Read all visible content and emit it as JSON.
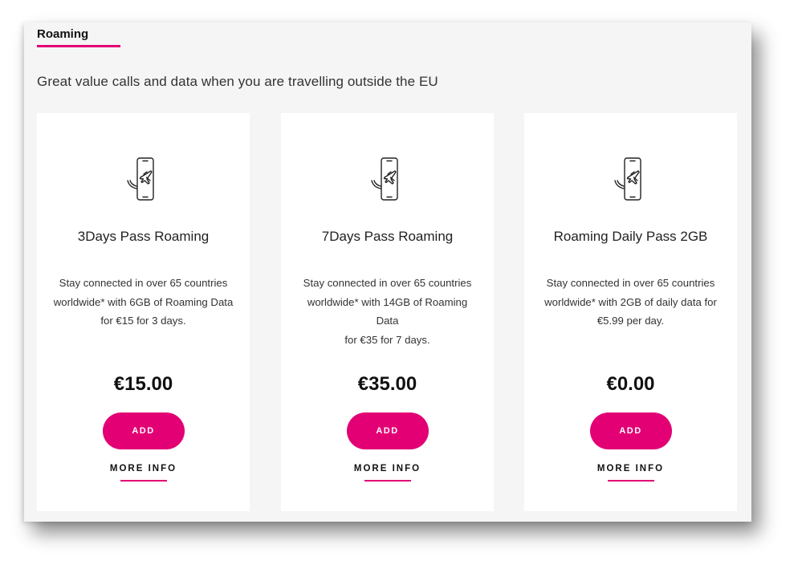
{
  "tab": {
    "label": "Roaming"
  },
  "subtitle": "Great value calls and data when you are travelling outside the EU",
  "colors": {
    "accent": "#e20074"
  },
  "cards": [
    {
      "icon": "roaming-phone-plane-icon",
      "title": "3Days Pass Roaming",
      "desc": [
        "Stay connected in over 65 countries",
        "worldwide* with 6GB of Roaming Data",
        "for €15 for 3 days."
      ],
      "price": "€15.00",
      "add_label": "ADD",
      "more_label": "MORE INFO"
    },
    {
      "icon": "roaming-phone-plane-icon",
      "title": "7Days Pass Roaming",
      "desc": [
        "Stay connected in over 65 countries",
        "worldwide* with 14GB of Roaming Data",
        "for €35 for 7 days."
      ],
      "price": "€35.00",
      "add_label": "ADD",
      "more_label": "MORE INFO"
    },
    {
      "icon": "roaming-phone-plane-icon",
      "title": "Roaming Daily Pass 2GB",
      "desc": [
        "Stay connected in over 65 countries",
        "worldwide* with 2GB of daily data for",
        "€5.99 per day."
      ],
      "price": "€0.00",
      "add_label": "ADD",
      "more_label": "MORE INFO"
    }
  ]
}
